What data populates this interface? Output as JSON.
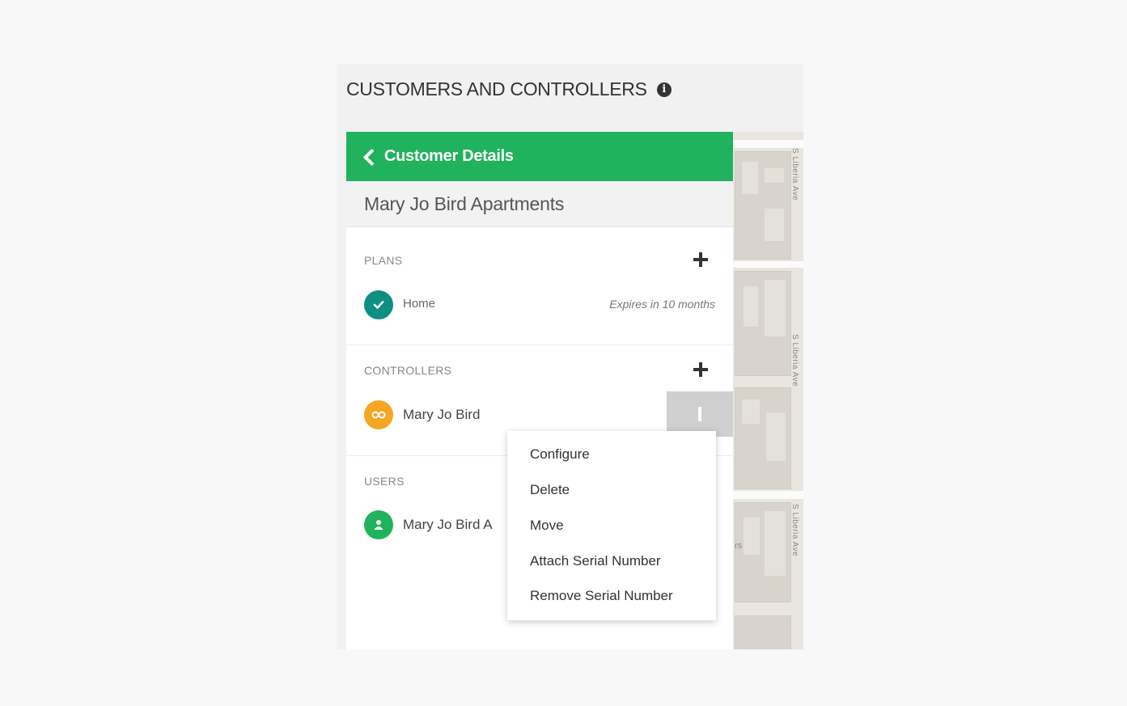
{
  "page_title": "CUSTOMERS AND CONTROLLERS",
  "panel": {
    "back_label": "Customer Details",
    "customer_name": "Mary Jo Bird Apartments",
    "plans": {
      "label": "PLANS",
      "items": [
        {
          "name": "Home",
          "status": "Expires in 10 months"
        }
      ]
    },
    "controllers": {
      "label": "CONTROLLERS",
      "items": [
        {
          "name": "Mary Jo Bird"
        }
      ]
    },
    "users": {
      "label": "USERS",
      "items": [
        {
          "name": "Mary Jo Bird A"
        }
      ]
    }
  },
  "context_menu": {
    "items": [
      "Configure",
      "Delete",
      "Move",
      "Attach Serial Number",
      "Remove Serial Number"
    ]
  },
  "map": {
    "street_labels": [
      "S Liberia Ave",
      "S Liberia Ave",
      "S Liberia Ave"
    ],
    "partial_label": "rs"
  },
  "colors": {
    "header_green": "#20b25c",
    "plan_icon": "#0f8f81",
    "controller_icon": "#f5a623",
    "user_icon": "#20b25c"
  },
  "icons": {
    "info": "info-circle-icon",
    "back": "chevron-left-icon",
    "add": "plus-icon",
    "plan": "check-circle-icon",
    "controller": "controller-icon",
    "user": "user-icon",
    "menu": "kebab-menu-icon"
  }
}
